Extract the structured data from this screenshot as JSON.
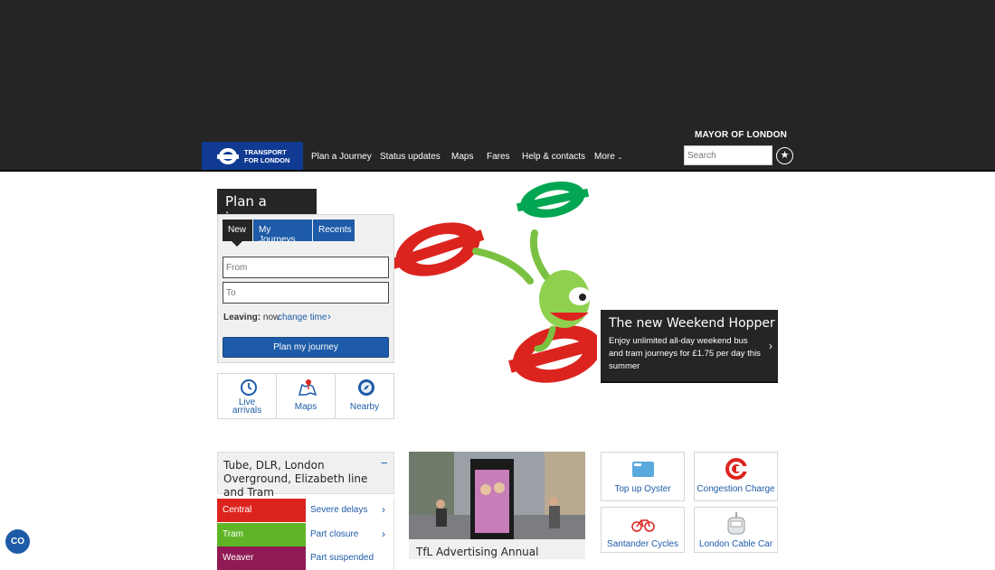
{
  "header": {
    "mayor": "MAYOR OF LONDON",
    "logo_line1": "TRANSPORT",
    "logo_line2": "FOR LONDON",
    "nav": [
      {
        "label": "Plan a Journey"
      },
      {
        "label": "Status updates"
      },
      {
        "label": "Maps"
      },
      {
        "label": "Fares"
      },
      {
        "label": "Help & contacts"
      },
      {
        "label": "More"
      }
    ],
    "search_placeholder": "Search"
  },
  "planner": {
    "title": "Plan a journey",
    "tabs": [
      "New",
      "My Journeys",
      "Recents"
    ],
    "from_placeholder": "From",
    "to_placeholder": "To",
    "leaving_label": "Leaving:",
    "leaving_value": "now",
    "change_time": "change time",
    "submit": "Plan my journey"
  },
  "quick_links": [
    {
      "icon": "clock-icon",
      "label_line1": "Live",
      "label_line2": "arrivals"
    },
    {
      "icon": "map-icon",
      "label_line1": "Maps",
      "label_line2": ""
    },
    {
      "icon": "compass-icon",
      "label_line1": "Nearby",
      "label_line2": ""
    }
  ],
  "promo": {
    "title": "The new Weekend Hopper",
    "text": "Enjoy unlimited all-day weekend bus and tram journeys for £1.75 per day this summer"
  },
  "status": {
    "heading": "Tube, DLR, London Overground, Elizabeth line and Tram",
    "collapse": "−",
    "rows": [
      {
        "line": "Central",
        "status": "Severe delays",
        "color": "#dc241f"
      },
      {
        "line": "Tram",
        "status": "Part closure",
        "color": "#5fb526"
      },
      {
        "line": "Weaver",
        "status": "Part suspended",
        "color": "#8f1a54"
      }
    ]
  },
  "news": {
    "title": "TfL Advertising Annual"
  },
  "tiles": [
    {
      "icon": "oyster-card-icon",
      "label": "Top up Oyster"
    },
    {
      "icon": "congestion-charge-icon",
      "label": "Congestion Charge"
    },
    {
      "icon": "bicycle-icon",
      "label": "Santander Cycles"
    },
    {
      "icon": "cable-car-icon",
      "label": "London Cable Car"
    }
  ],
  "accessibility": {
    "label": "CO"
  },
  "colors": {
    "brand_blue": "#113b92",
    "link_blue": "#1d5ba8",
    "dark": "#252525",
    "roundel_red": "#dc241f",
    "roundel_green": "#00a651"
  }
}
